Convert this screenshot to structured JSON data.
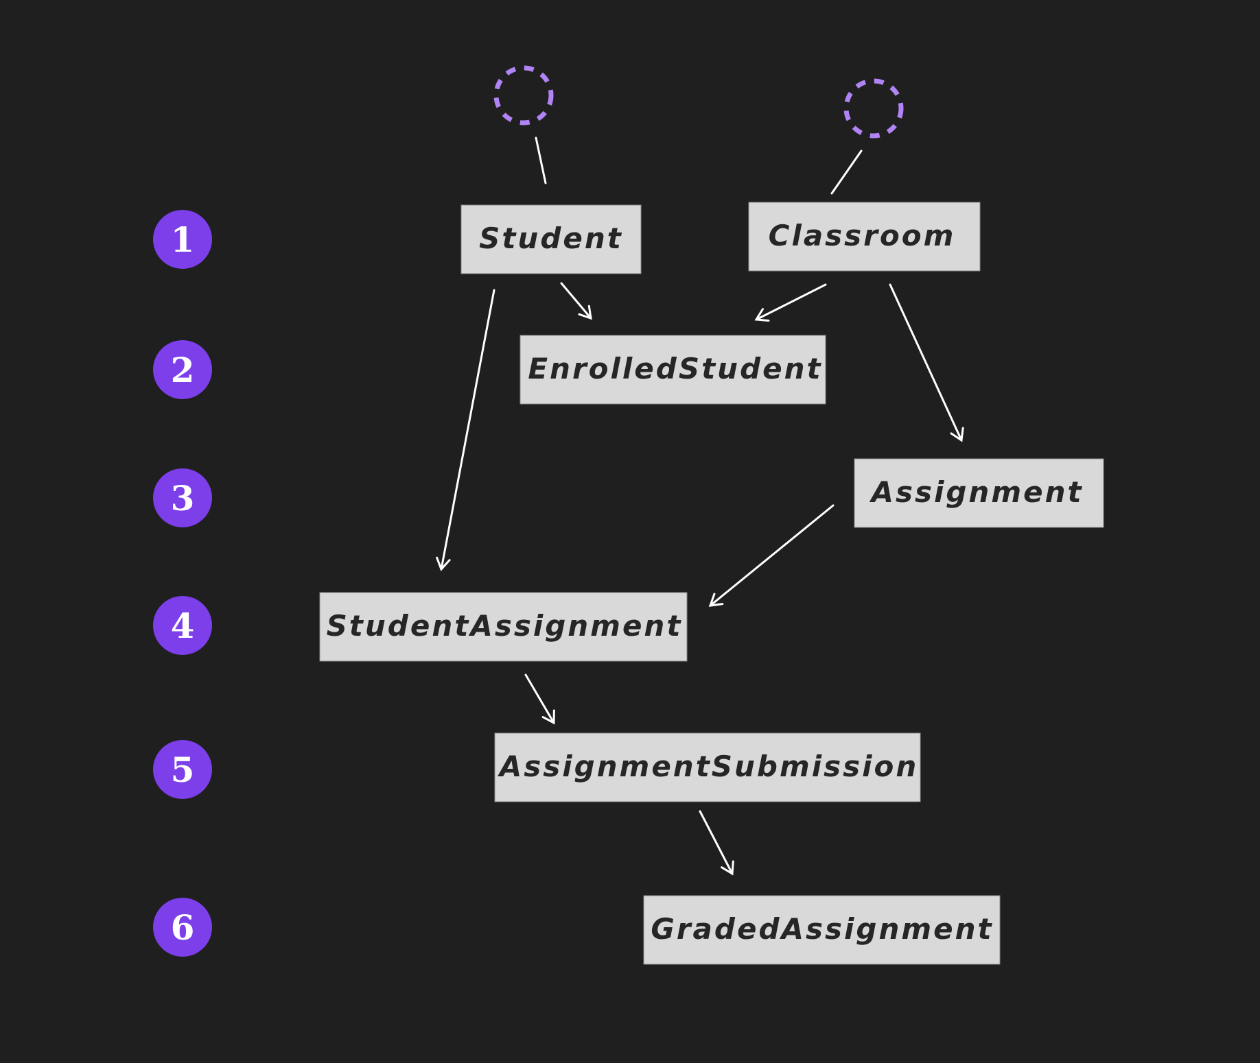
{
  "diagram": {
    "steps": [
      "1",
      "2",
      "3",
      "4",
      "5",
      "6"
    ],
    "colors": {
      "background": "#1f1f1f",
      "step_circle": "#7c3fea",
      "start_marker": "#b084f5",
      "node_fill": "#d9d9d9",
      "node_text": "#262626",
      "edge": "#ffffff"
    },
    "nodes": [
      {
        "id": "student",
        "label": "Student",
        "step": 1
      },
      {
        "id": "classroom",
        "label": "Classroom",
        "step": 1
      },
      {
        "id": "enrolled-student",
        "label": "EnrolledStudent",
        "step": 2
      },
      {
        "id": "assignment",
        "label": "Assignment",
        "step": 3
      },
      {
        "id": "student-assignment",
        "label": "StudentAssignment",
        "step": 4
      },
      {
        "id": "assignment-submission",
        "label": "AssignmentSubmission",
        "step": 5
      },
      {
        "id": "graded-assignment",
        "label": "GradedAssignment",
        "step": 6
      }
    ],
    "start_markers": [
      {
        "target": "student",
        "style": "dashed-circle"
      },
      {
        "target": "classroom",
        "style": "dashed-circle"
      }
    ],
    "edges": [
      {
        "from": "start",
        "to": "student",
        "arrow": false
      },
      {
        "from": "start",
        "to": "classroom",
        "arrow": false
      },
      {
        "from": "student",
        "to": "enrolled-student",
        "arrow": true
      },
      {
        "from": "classroom",
        "to": "enrolled-student",
        "arrow": true
      },
      {
        "from": "classroom",
        "to": "assignment",
        "arrow": true
      },
      {
        "from": "student",
        "to": "student-assignment",
        "arrow": true
      },
      {
        "from": "assignment",
        "to": "student-assignment",
        "arrow": true
      },
      {
        "from": "student-assignment",
        "to": "assignment-submission",
        "arrow": true
      },
      {
        "from": "assignment-submission",
        "to": "graded-assignment",
        "arrow": true
      }
    ]
  }
}
